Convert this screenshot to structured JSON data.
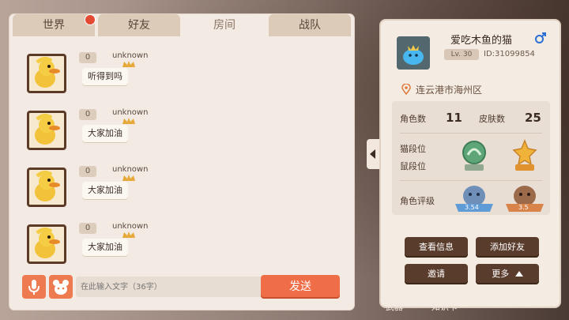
{
  "tabs": [
    "世界",
    "好友",
    "房间",
    "战队"
  ],
  "messages": [
    {
      "level": "0",
      "user": "unknown",
      "text": "听得到吗"
    },
    {
      "level": "0",
      "user": "unknown",
      "text": "大家加油"
    },
    {
      "level": "0",
      "user": "unknown",
      "text": "大家加油"
    },
    {
      "level": "0",
      "user": "unknown",
      "text": "大家加油"
    }
  ],
  "input": {
    "placeholder": "在此输入文字（36字）"
  },
  "send_label": "发送",
  "profile": {
    "name": "爱吃木鱼的猫",
    "level": "Lv. 30",
    "id": "ID:31099854",
    "location": "连云港市海州区",
    "role_count_label": "角色数",
    "role_count": "11",
    "skin_count_label": "皮肤数",
    "skin_count": "25",
    "cat_rank_label": "猫段位",
    "mouse_rank_label": "鼠段位",
    "role_rating_label": "角色评级",
    "rating_badge_1": "3.54",
    "rating_badge_2": "3.5",
    "buttons": {
      "view": "查看信息",
      "add": "添加好友",
      "invite": "邀请",
      "more": "更多"
    }
  },
  "bottom_nav": [
    "武器",
    "知识卡"
  ],
  "colors": {
    "accent": "#ef6e47",
    "dark_button": "#5a3c2c",
    "panel": "#f3ebe3"
  }
}
